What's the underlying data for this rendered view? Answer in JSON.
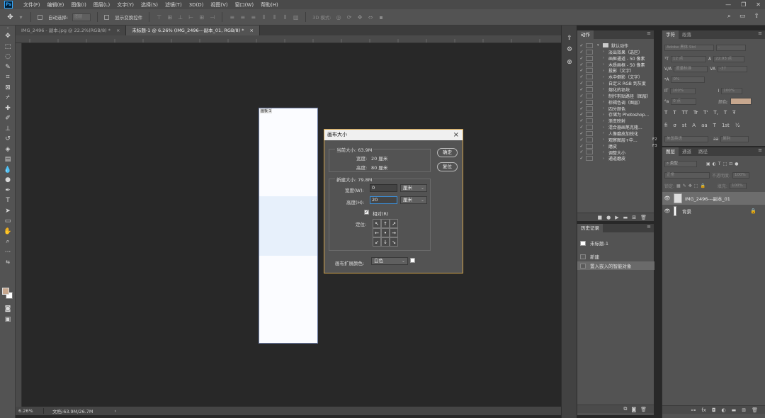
{
  "menu": {
    "logo": "Ps",
    "items": [
      "文件(F)",
      "编辑(E)",
      "图像(I)",
      "图层(L)",
      "文字(Y)",
      "选择(S)",
      "滤镜(T)",
      "3D(D)",
      "视图(V)",
      "窗口(W)",
      "帮助(H)"
    ]
  },
  "options": {
    "auto_select_label": "自动选择:",
    "auto_select_value": "图层",
    "show_transform_label": "显示变换控件",
    "mode_3d_label": "3D 模式:"
  },
  "tabs": [
    {
      "label": "IMG_2496 - 副本.jpg @ 22.2%(RGB/8) *",
      "close": "×"
    },
    {
      "label": "未标题-1 @ 6.26% (IMG_2496---副本_01, RGB/8) *",
      "close": "×"
    }
  ],
  "canvas": {
    "doc_label": "画板 1"
  },
  "status": {
    "zoom": "6.26%",
    "doc": "文档:63.9M/26.7M",
    "arrow": "›"
  },
  "dialog": {
    "title": "画布大小",
    "close": "×",
    "current_label": "当前大小: 63.9M",
    "current_width_label": "宽度:",
    "current_width_value": "20 厘米",
    "current_height_label": "高度:",
    "current_height_value": "80 厘米",
    "new_label": "新建大小: 79.8M",
    "width_label": "宽度(W):",
    "width_value": "0",
    "width_unit": "厘米",
    "height_label": "高度(H):",
    "height_value": "20",
    "height_unit": "厘米",
    "relative_label": "相对(R)",
    "relative_checked": true,
    "anchor_label": "定位:",
    "anchor_cells": [
      "↖",
      "↑",
      "↗",
      "←",
      "•",
      "→",
      "↙",
      "↓",
      "↘"
    ],
    "ext_color_label": "画布扩展颜色:",
    "ext_color_value": "白色",
    "ok_label": "确定",
    "reset_label": "复位"
  },
  "actions_panel": {
    "tab": "动作",
    "set_name": "默认动作",
    "items": [
      {
        "name": "淡出效果（选区）",
        "key": ""
      },
      {
        "name": "画框通道 - 50 像素",
        "key": ""
      },
      {
        "name": "木质画框 - 50 像素",
        "key": ""
      },
      {
        "name": "投影（文字）",
        "key": ""
      },
      {
        "name": "水中倒影（文字）",
        "key": ""
      },
      {
        "name": "自定义 RGB 到灰度",
        "key": ""
      },
      {
        "name": "熔化的铅块",
        "key": ""
      },
      {
        "name": "制作剪贴路径（图层）",
        "key": ""
      },
      {
        "name": "棕褐色调（图层）",
        "key": ""
      },
      {
        "name": "四分颜色",
        "key": ""
      },
      {
        "name": "存储为 Photoshop...",
        "key": ""
      },
      {
        "name": "渐变映射",
        "key": ""
      },
      {
        "name": "混合器画笔克隆...",
        "key": ""
      },
      {
        "name": "人像磨皮加锐化",
        "key": ""
      },
      {
        "name": "观察图层+中...",
        "key": "F2"
      },
      {
        "name": "磨皮",
        "key": "F3"
      },
      {
        "name": "调整大小",
        "key": ""
      },
      {
        "name": "通道磨皮",
        "key": ""
      }
    ]
  },
  "history_panel": {
    "tab": "历史记录",
    "snapshot": "未标题-1",
    "items": [
      "新建",
      "置入嵌入的智能对象"
    ]
  },
  "char_panel": {
    "tabs": [
      "字符",
      "段落"
    ],
    "font": "Adobe 黑体 Std",
    "font_style": "-",
    "size": "12 点",
    "leading": "22.93 点",
    "tracking": "度量标准",
    "kerning": "-37",
    "vscale": "0%",
    "hscale_a": "100%",
    "hscale_b": "100%",
    "baseline": "0 点",
    "color_label": "颜色:",
    "color": "#c7a78e",
    "style_buttons": [
      "T",
      "T",
      "TT",
      "Tr",
      "T'",
      "T,",
      "T",
      "Ŧ"
    ],
    "extra_buttons": [
      "fi",
      "σ",
      "st",
      "A",
      "aa",
      "T",
      "1st",
      "½"
    ],
    "language": "美国英语",
    "aa_label": "aa",
    "aa_value": "犀利"
  },
  "layers_panel": {
    "tabs": [
      "图层",
      "通道",
      "路径"
    ],
    "kind_label": "类型",
    "blend_mode": "正常",
    "opacity_label": "不透明度:",
    "opacity_value": "100%",
    "lock_label": "锁定:",
    "fill_label": "填充:",
    "fill_value": "100%",
    "layers": [
      {
        "name": "IMG_2496---副本_01",
        "selected": true
      },
      {
        "name": "背景",
        "selected": false
      }
    ]
  }
}
